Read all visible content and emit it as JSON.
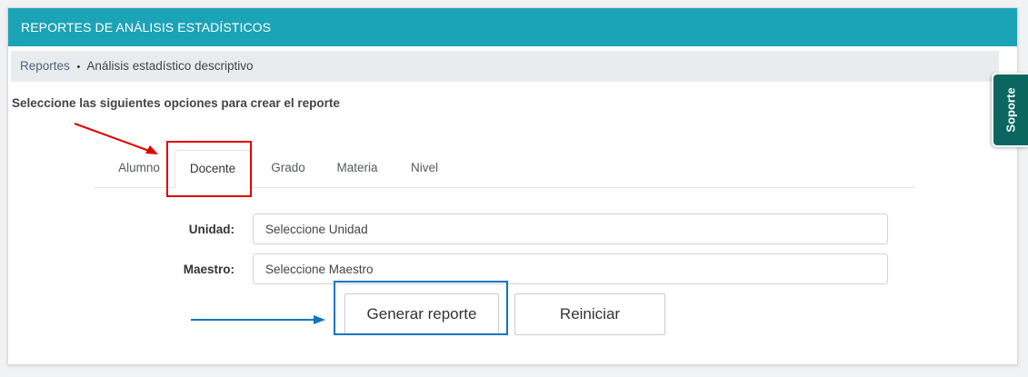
{
  "header": {
    "title": "REPORTES DE ANÁLISIS ESTADÍSTICOS"
  },
  "breadcrumb": {
    "root": "Reportes",
    "separator": "•",
    "current": "Análisis estadístico descriptivo"
  },
  "instructions": "Seleccione las siguientes opciones para crear el reporte",
  "tabs": [
    {
      "label": "Alumno",
      "active": false
    },
    {
      "label": "Docente",
      "active": true
    },
    {
      "label": "Grado",
      "active": false
    },
    {
      "label": "Materia",
      "active": false
    },
    {
      "label": "Nivel",
      "active": false
    }
  ],
  "form": {
    "unidad": {
      "label": "Unidad:",
      "placeholder": "Seleccione Unidad",
      "value": ""
    },
    "maestro": {
      "label": "Maestro:",
      "placeholder": "Seleccione Maestro",
      "value": ""
    }
  },
  "buttons": {
    "generate": "Generar reporte",
    "reset": "Reiniciar"
  },
  "support": {
    "label": "Soporte"
  },
  "colors": {
    "header": "#1ba3b6",
    "annotation_red": "#e00000",
    "annotation_blue": "#0a76c4",
    "support_tab": "#0b6660"
  }
}
